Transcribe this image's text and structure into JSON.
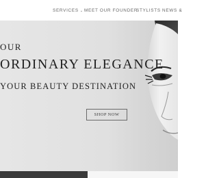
{
  "nav": {
    "items": [
      {
        "label": "SERVICES",
        "has_dropdown": true
      },
      {
        "label": "MEET OUR FOUNDER"
      },
      {
        "label": "STYLISTS"
      },
      {
        "label": "NEWS &"
      }
    ]
  },
  "hero": {
    "line1": "OUR",
    "line2": "ORDINARY ELEGANCE",
    "line3": "YOUR BEAUTY DESTINATION",
    "cta_label": "SHOP NOW"
  },
  "colors": {
    "hero_bg": "#e3e3e3",
    "text_dark": "#1f1f1f",
    "nav_text": "#666666",
    "footer_dark": "#3a3a3a"
  }
}
